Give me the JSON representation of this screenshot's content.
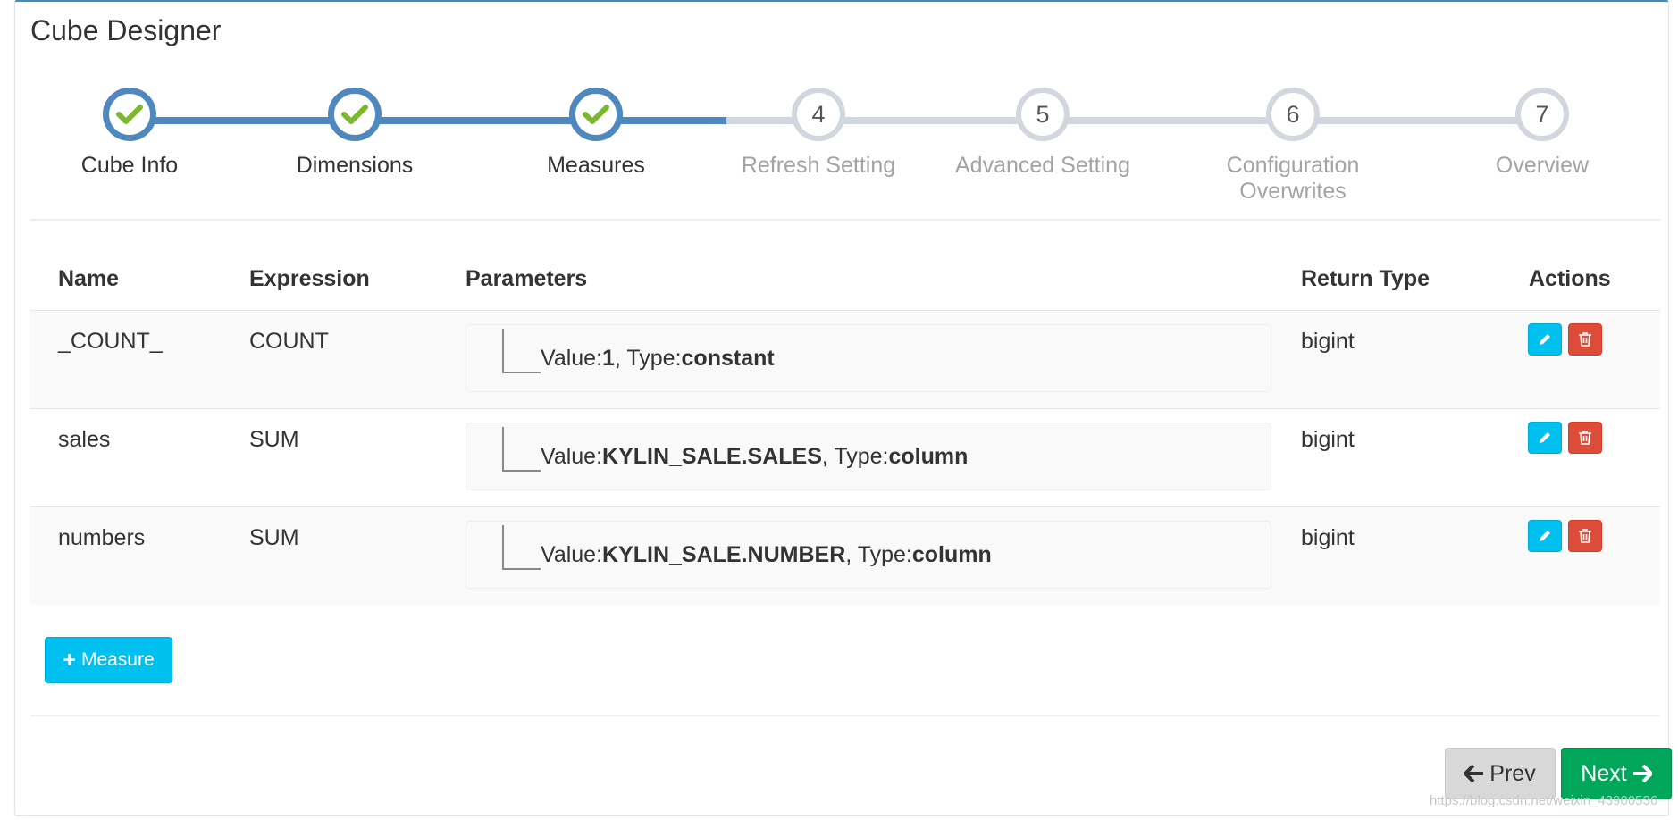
{
  "title": "Cube Designer",
  "wizard": {
    "steps": [
      {
        "label": "Cube Info",
        "number": "1",
        "status": "done"
      },
      {
        "label": "Dimensions",
        "number": "2",
        "status": "done"
      },
      {
        "label": "Measures",
        "number": "3",
        "status": "done"
      },
      {
        "label": "Refresh Setting",
        "number": "4",
        "status": "todo"
      },
      {
        "label": "Advanced Setting",
        "number": "5",
        "status": "todo"
      },
      {
        "label": "Configuration Overwrites",
        "number": "6",
        "status": "todo"
      },
      {
        "label": "Overview",
        "number": "7",
        "status": "todo"
      }
    ]
  },
  "table": {
    "headers": {
      "name": "Name",
      "expression": "Expression",
      "parameters": "Parameters",
      "return_type": "Return Type",
      "actions": "Actions"
    },
    "rows": [
      {
        "name": "_COUNT_",
        "expression": "COUNT",
        "value": "1",
        "type": "constant",
        "return_type": "bigint"
      },
      {
        "name": "sales",
        "expression": "SUM",
        "value": "KYLIN_SALE.SALES",
        "type": "column",
        "return_type": "bigint"
      },
      {
        "name": "numbers",
        "expression": "SUM",
        "value": "KYLIN_SALE.NUMBER",
        "type": "column",
        "return_type": "bigint"
      }
    ],
    "value_prefix": "Value:",
    "type_prefix": ", Type:"
  },
  "buttons": {
    "add_measure": "Measure",
    "prev": "Prev",
    "next": "Next"
  },
  "colors": {
    "done": "#4e88bd",
    "check": "#7cb82f",
    "todo": "#d2d6de",
    "info": "#00c0ef",
    "danger": "#dd4b39",
    "success": "#00a65a"
  },
  "watermark": "https://blog.csdn.net/weixin_43900536"
}
